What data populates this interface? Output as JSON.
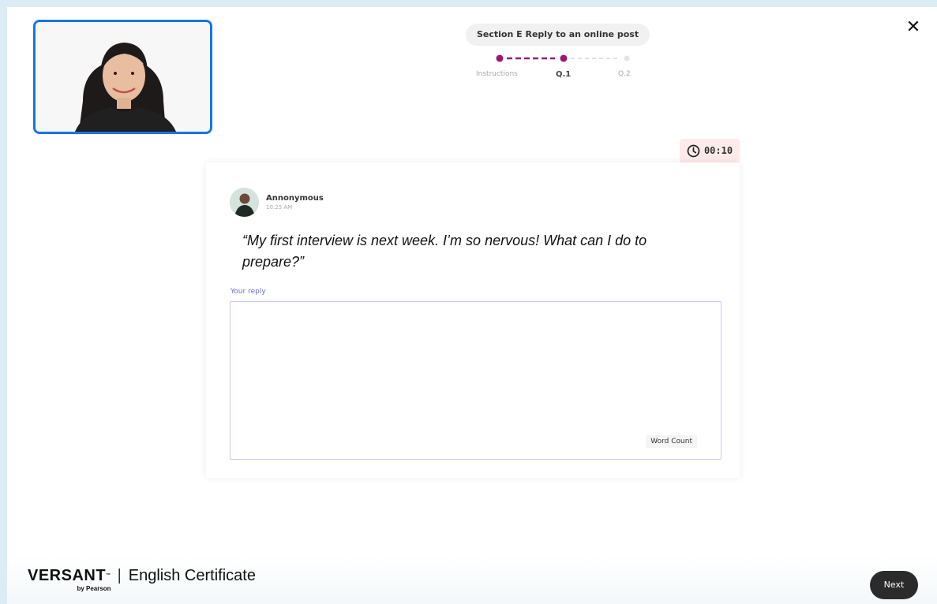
{
  "header": {
    "close_icon": "close-icon",
    "section_label": "Section E  Reply to an online post",
    "progress": {
      "steps": [
        {
          "label": "Instructions",
          "state": "completed"
        },
        {
          "label": "Q.1",
          "state": "current"
        },
        {
          "label": "Q.2",
          "state": "upcoming"
        }
      ],
      "active_color": "#9c1a6e"
    }
  },
  "timer": {
    "icon": "clock-icon",
    "value": "00:10",
    "background": "#fdeaea"
  },
  "post": {
    "author": "Annonymous",
    "time": "10:25 AM",
    "text": "“My first interview is next week. I’m so nervous! What can I do to prepare?”"
  },
  "reply": {
    "label": "Your reply",
    "value": "",
    "word_count_label": "Word Count",
    "border_color": "#c7c8f3"
  },
  "footer": {
    "brand": "VERSANT",
    "trademark": "™",
    "byline": "by Pearson",
    "separator": "|",
    "product": "English Certificate",
    "next_label": "Next"
  }
}
